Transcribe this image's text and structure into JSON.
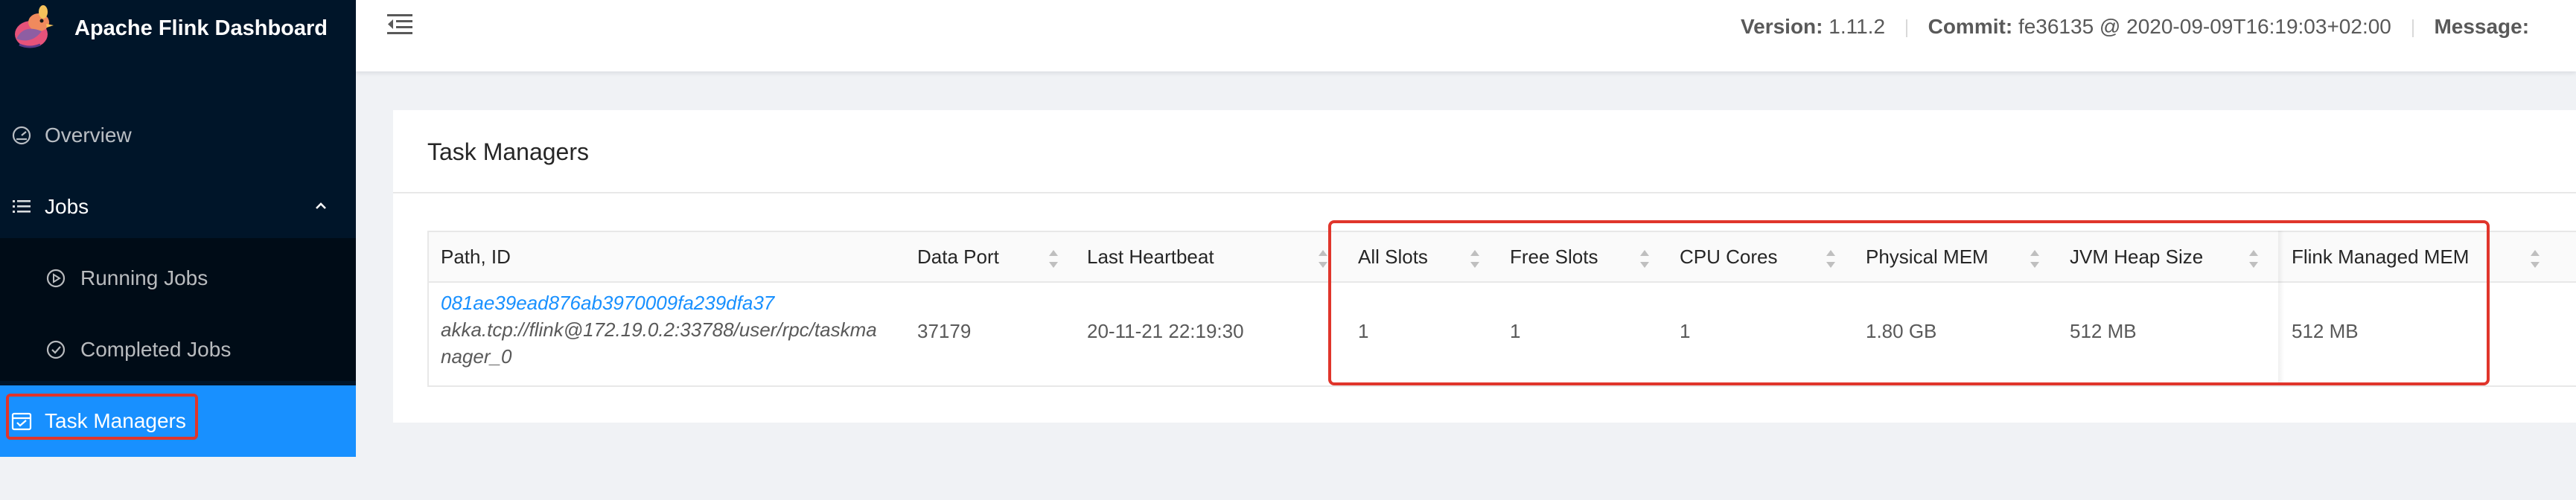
{
  "sidebar": {
    "title": "Apache Flink Dashboard",
    "items": [
      {
        "label": "Overview",
        "icon": "dashboard-icon"
      },
      {
        "label": "Jobs",
        "icon": "list-icon"
      },
      {
        "label": "Running Jobs",
        "icon": "play-circle-icon"
      },
      {
        "label": "Completed Jobs",
        "icon": "check-circle-icon"
      },
      {
        "label": "Task Managers",
        "icon": "schedule-icon",
        "active": true
      }
    ]
  },
  "header": {
    "version_key": "Version:",
    "version_value": "1.11.2",
    "commit_key": "Commit:",
    "commit_value": "fe36135 @ 2020-09-09T16:19:03+02:00",
    "message_key": "Message:"
  },
  "card": {
    "title": "Task Managers"
  },
  "table": {
    "columns": [
      "Path, ID",
      "Data Port",
      "Last Heartbeat",
      "All Slots",
      "Free Slots",
      "CPU Cores",
      "Physical MEM",
      "JVM Heap Size",
      "Flink Managed MEM"
    ],
    "rows": [
      {
        "id": "081ae39ead876ab3970009fa239dfa37",
        "path_line1": "akka.tcp://flink@172.19.0.2:33788/user/rpc/taskma",
        "path_line2": "nager_0",
        "data_port": "37179",
        "last_heartbeat": "20-11-21 22:19:30",
        "all_slots": "1",
        "free_slots": "1",
        "cpu_cores": "1",
        "physical_mem": "1.80 GB",
        "jvm_heap": "512 MB",
        "flink_managed_mem": "512 MB"
      }
    ]
  },
  "colors": {
    "sidebar_bg": "#001529",
    "submenu_bg": "#000c17",
    "active": "#1890ff",
    "highlight": "#e0352b",
    "link": "#1890ff"
  }
}
